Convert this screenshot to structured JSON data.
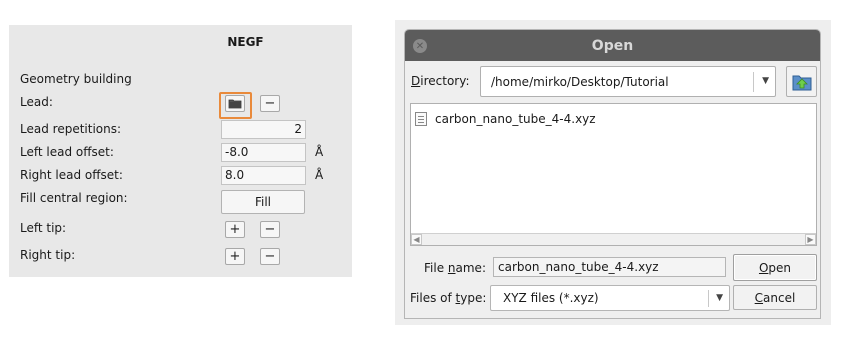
{
  "negf": {
    "title": "NEGF",
    "geometry_heading": "Geometry building",
    "lead_label": "Lead:",
    "lead_repetitions_label": "Lead repetitions:",
    "lead_repetitions_value": "2",
    "left_offset_label": "Left lead offset:",
    "left_offset_value": "-8.0",
    "right_offset_label": "Right lead offset:",
    "right_offset_value": "8.0",
    "unit": "Å",
    "fill_central_label": "Fill central region:",
    "fill_button": "Fill",
    "left_tip_label": "Left tip:",
    "right_tip_label": "Right tip:",
    "plus": "+",
    "minus": "−",
    "highlight_color": "#e98a3b"
  },
  "dialog": {
    "title": "Open",
    "directory_label_u": "D",
    "directory_label_rest": "irectory:",
    "directory_path": "/home/mirko/Desktop/Tutorial",
    "files": [
      "carbon_nano_tube_4-4.xyz"
    ],
    "file_name_label_pre": "File ",
    "file_name_label_u": "n",
    "file_name_label_post": "ame:",
    "file_name_value": "carbon_nano_tube_4-4.xyz",
    "file_type_label_pre": "Files of ",
    "file_type_label_u": "t",
    "file_type_label_post": "ype:",
    "file_type_value": "XYZ files (*.xyz)",
    "open_button_u": "O",
    "open_button_rest": "pen",
    "cancel_button_u": "C",
    "cancel_button_rest": "ancel",
    "icons": [
      "close-icon",
      "folder-up-icon",
      "document-icon",
      "chevron-down-icon",
      "folder-icon"
    ]
  }
}
